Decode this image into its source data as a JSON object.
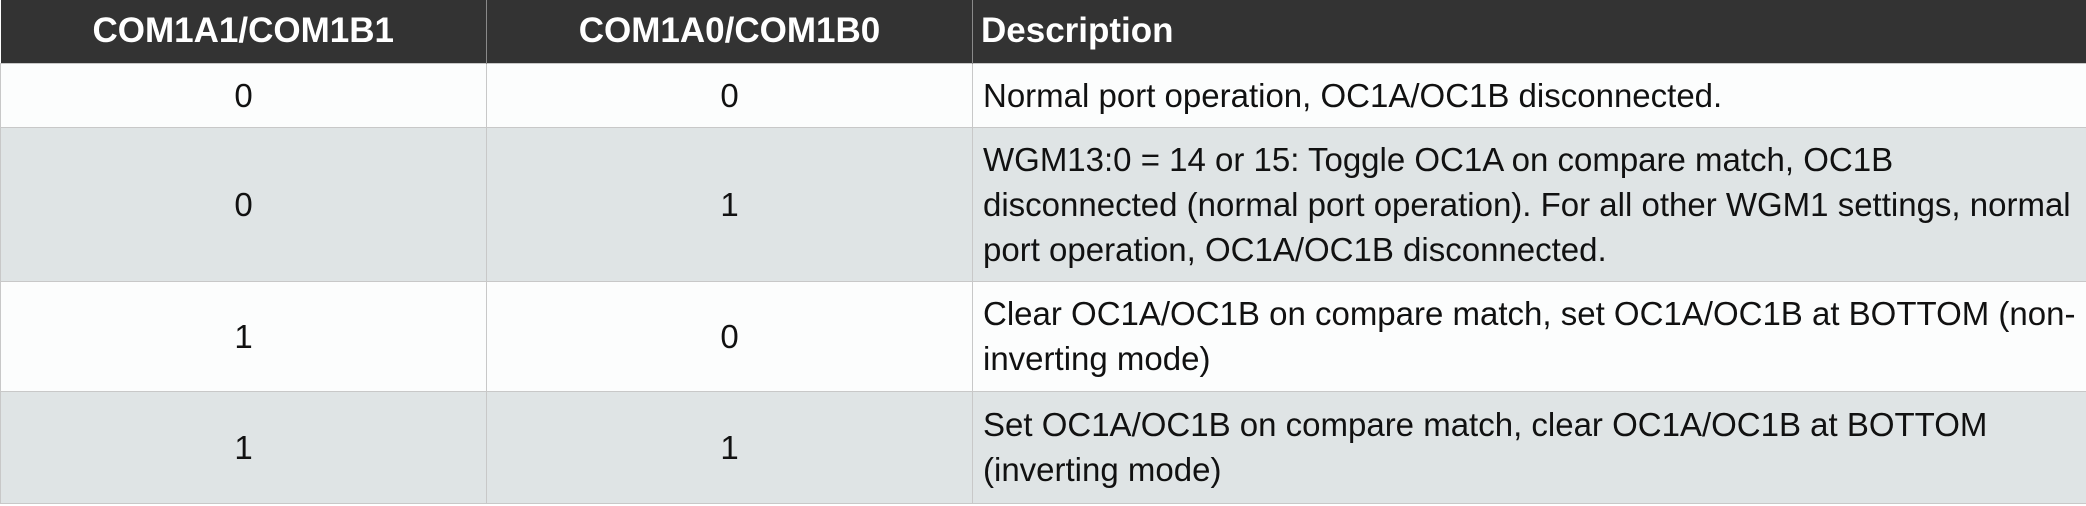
{
  "table": {
    "headers": [
      "COM1A1/COM1B1",
      "COM1A0/COM1B0",
      "Description"
    ],
    "rows": [
      {
        "com1": "0",
        "com0": "0",
        "description": "Normal port operation, OC1A/OC1B disconnected."
      },
      {
        "com1": "0",
        "com0": "1",
        "description": "WGM13:0 = 14 or 15: Toggle OC1A on compare match, OC1B disconnected (normal port operation). For all other WGM1 settings, normal port operation, OC1A/OC1B disconnected."
      },
      {
        "com1": "1",
        "com0": "0",
        "description": "Clear OC1A/OC1B on compare match, set OC1A/OC1B at BOTTOM (non-inverting mode)"
      },
      {
        "com1": "1",
        "com0": "1",
        "description": "Set OC1A/OC1B on compare match, clear OC1A/OC1B at BOTTOM (inverting mode)"
      }
    ]
  },
  "colors": {
    "header_bg": "#333333",
    "header_text": "#ffffff",
    "row_light": "#fcfdfd",
    "row_gray": "#dfe4e5"
  }
}
